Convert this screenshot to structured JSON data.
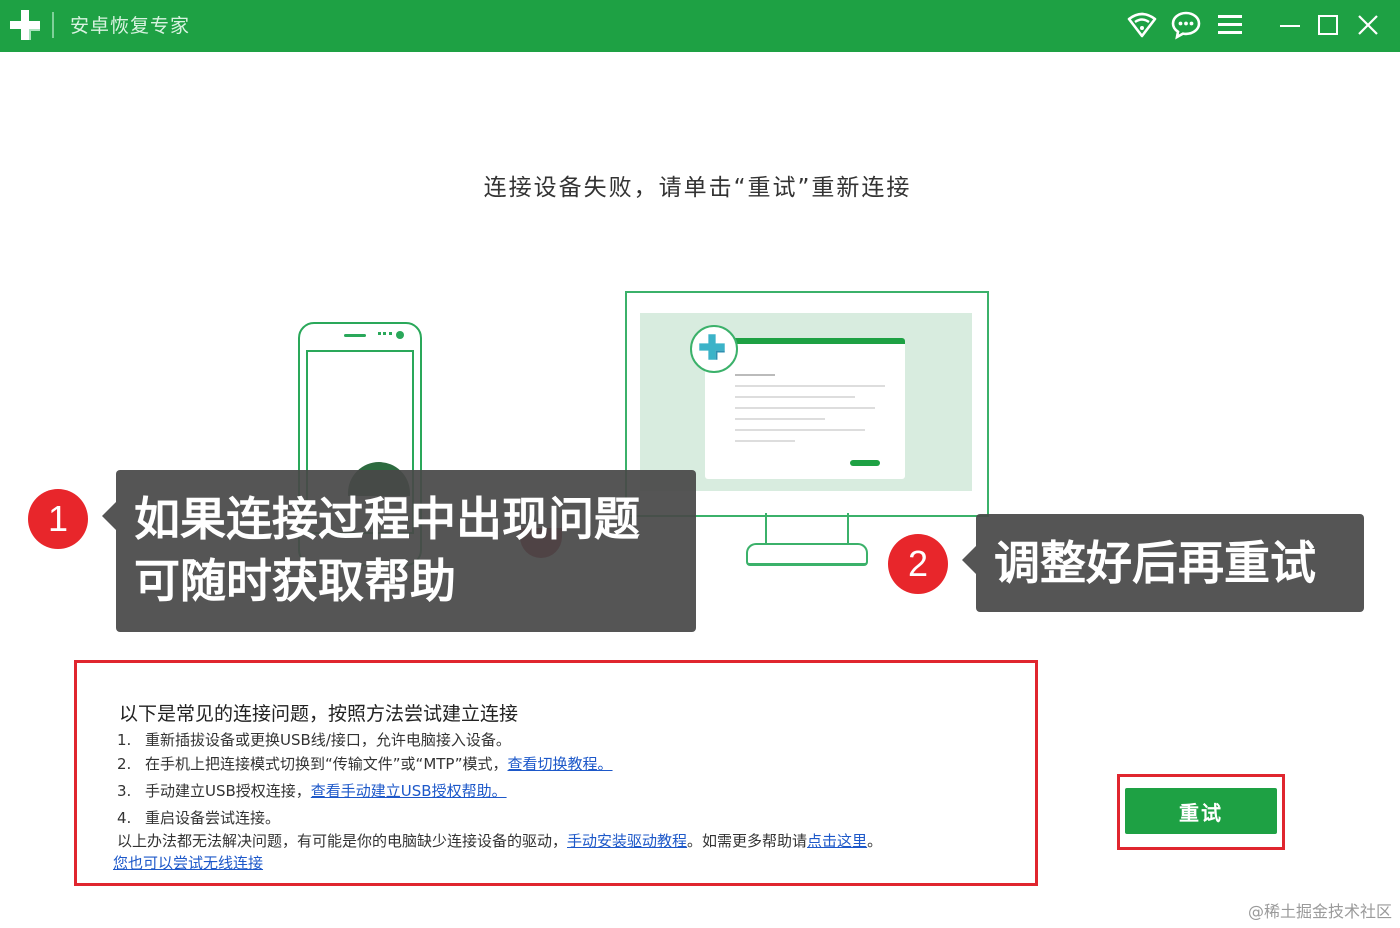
{
  "window": {
    "title": "安卓恢复专家",
    "icons": [
      "app-logo-icon",
      "wifi-icon",
      "chat-icon",
      "menu-icon",
      "minimize-icon",
      "maximize-icon",
      "close-icon"
    ]
  },
  "main": {
    "heading": "连接设备失败，请单击“重试”重新连接"
  },
  "callouts": [
    {
      "number": "1",
      "lines": [
        "如果连接过程中出现问题",
        "可随时获取帮助"
      ]
    },
    {
      "number": "2",
      "lines": [
        "调整好后再重试"
      ]
    }
  ],
  "help": {
    "title": "以下是常见的连接问题，按照方法尝试建立连接",
    "items": [
      {
        "num": "1.",
        "text": "重新插拔设备或更换USB线/接口，允许电脑接入设备。"
      },
      {
        "num": "2.",
        "text": "在手机上把连接模式切换到“传输文件”或“MTP”模式，",
        "link": "查看切换教程。"
      },
      {
        "num": "3.",
        "text": "手动建立USB授权连接，",
        "link": "查看手动建立USB授权帮助。"
      },
      {
        "num": "4.",
        "text": "重启设备尝试连接。"
      }
    ],
    "footer": {
      "text1": "以上办法都无法解决问题，有可能是你的电脑缺少连接设备的驱动，",
      "link1": "手动安装驱动教程",
      "text2": "。如需更多帮助请",
      "link2": "点击这里",
      "text3": "。",
      "wireless_link": "您也可以尝试无线连接"
    }
  },
  "retry_button": {
    "label": "重试"
  },
  "watermark": "@稀土掘金技术社区",
  "colors": {
    "brand_green": "#1ea144",
    "highlight_red": "#e0262f",
    "badge_red": "#e8262b",
    "link_blue": "#1d58c9"
  }
}
